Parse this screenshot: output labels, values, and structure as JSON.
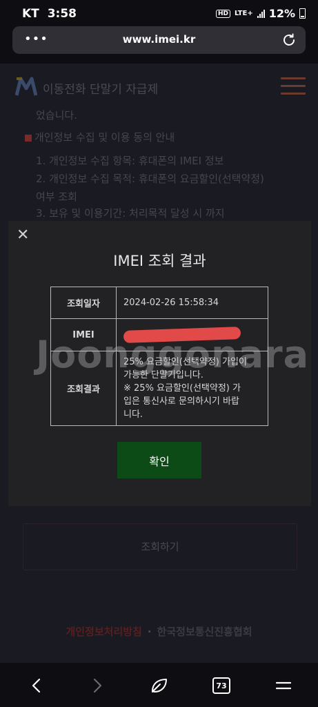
{
  "status": {
    "carrier": "KT",
    "time": "3:58",
    "hd": "HD",
    "network": "LTE+",
    "battery": "12%"
  },
  "browser": {
    "url": "www.imei.kr",
    "menu_glyph": "•••",
    "tabs_count": "73"
  },
  "page": {
    "site_name": "이동전화 단말기 자급제",
    "lines": [
      "었습니다.",
      "개인정보 수집 및 이용 동의 안내",
      "1. 개인정보 수집 항목: 휴대폰의 IMEI 정보",
      "2. 개인정보 수집 목적: 휴대폰의 요금할인(선택약정)",
      "여부 조회",
      "3. 보유 및 이용기간: 처리목적 달성 시 까지"
    ],
    "query_button": "조회하기",
    "footer_privacy": "개인정보처리방침",
    "footer_sep": "·",
    "footer_org": "한국정보통신진흥협회"
  },
  "modal": {
    "close_glyph": "✕",
    "title": "IMEI 조회 결과",
    "rows": [
      {
        "label": "조회일자",
        "value": "2024-02-26 15:58:34"
      },
      {
        "label": "IMEI",
        "value": ""
      },
      {
        "label": "조회결과",
        "value_lines": [
          "25% 요금할인(선택약정) 가입이",
          "가능한 단말기입니다.",
          "※ 25% 요금할인(선택약정) 가",
          "입은 통신사로 문의하시기 바랍",
          "니다."
        ]
      }
    ],
    "confirm_label": "확인"
  },
  "watermark": "Joonggonara",
  "colors": {
    "confirm": "#0c4a16",
    "redaction": "#e24a4a",
    "background": "#15151c"
  }
}
